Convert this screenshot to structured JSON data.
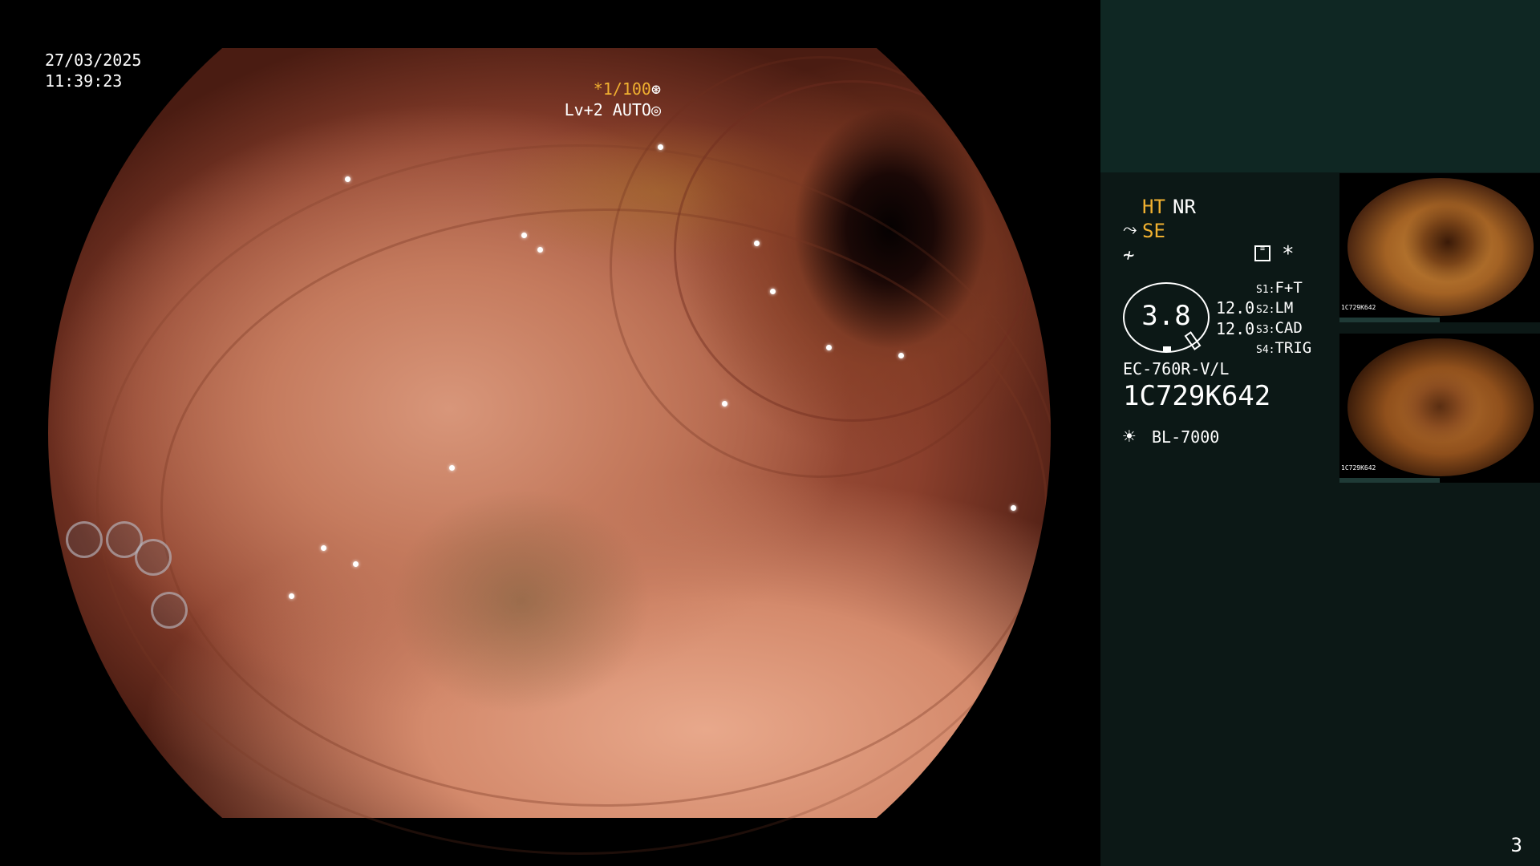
{
  "overlay": {
    "date": "27/03/2025",
    "time": "11:39:23",
    "shutter": "*1/100",
    "shutter_icon": "aperture-icon",
    "level": "Lv+2 AUTO",
    "level_icon": "iris-icon"
  },
  "panel": {
    "ht": "HT",
    "nr": "NR",
    "se": "SE",
    "zoom": "3.8",
    "num_top": "12.0",
    "num_bottom": "12.0",
    "switches": [
      {
        "key": "S1",
        "value": "F+T"
      },
      {
        "key": "S2",
        "value": "LM"
      },
      {
        "key": "S3",
        "value": "CAD"
      },
      {
        "key": "S4",
        "value": "TRIG"
      }
    ],
    "scope_model": "EC-760R-V/L",
    "serial": "1C729K642",
    "light_source": "BL-7000",
    "asterisk": "*",
    "page_number": "3"
  },
  "thumbnails": [
    {
      "label": "1C729K642"
    },
    {
      "label": "1C729K642"
    }
  ],
  "colors": {
    "accent": "#f0b030",
    "panel_bg": "#0c1816",
    "panel_top": "#0f2723"
  }
}
